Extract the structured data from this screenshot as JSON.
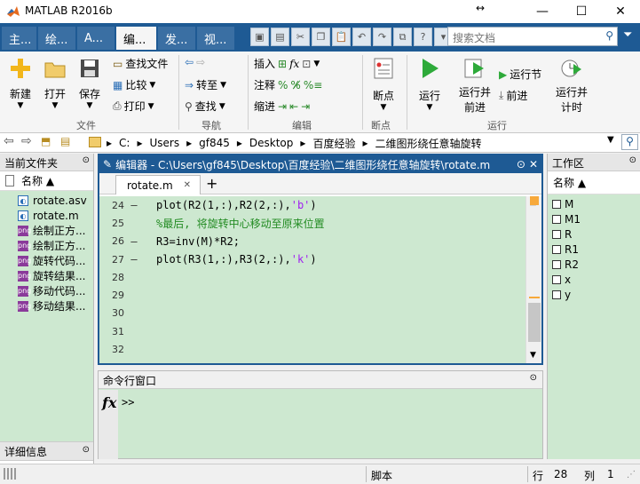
{
  "window": {
    "title": "MATLAB R2016b",
    "minimize": "—",
    "maximize": "☐",
    "close": "✕"
  },
  "tabs": [
    "主...",
    "绘...",
    "A...",
    "编...",
    "发...",
    "视..."
  ],
  "search": {
    "placeholder": "搜索文档"
  },
  "ribbon": {
    "new": "新建",
    "open": "打开",
    "save": "保存",
    "find_files": "查找文件",
    "compare": "比较",
    "print": "打印",
    "goto": "转至",
    "find": "查找",
    "insert": "插入",
    "comment": "注释",
    "indent": "缩进",
    "breakpoints": "断点",
    "run": "运行",
    "run_advance": [
      "运行并",
      "前进"
    ],
    "run_section": "运行节",
    "advance": "前进",
    "run_time": [
      "运行并",
      "计时"
    ],
    "groups": {
      "file": "文件",
      "navigate": "导航",
      "edit": "编辑",
      "breakpoints": "断点",
      "run": "运行"
    }
  },
  "path": [
    "C:",
    "Users",
    "gf845",
    "Desktop",
    "百度经验",
    "二维图形绕任意轴旋转"
  ],
  "current_folder": {
    "title": "当前文件夹",
    "column": "名称 ▲",
    "files": [
      "rotate.asv",
      "rotate.m",
      "绘制正方...",
      "绘制正方...",
      "旋转代码...",
      "旋转结果...",
      "移动代码...",
      "移动结果..."
    ],
    "details": "详细信息"
  },
  "editor": {
    "title": "编辑器 - C:\\Users\\gf845\\Desktop\\百度经验\\二维图形绕任意轴旋转\\rotate.m",
    "tab": "rotate.m",
    "lines": [
      {
        "num": "24",
        "dash": "—",
        "code": "plot(R2(1,:),R2(2,:),'b')"
      },
      {
        "num": "25",
        "dash": "",
        "code": "%最后, 将旋转中心移动至原来位置"
      },
      {
        "num": "26",
        "dash": "—",
        "code": "R3=inv(M)*R2;"
      },
      {
        "num": "27",
        "dash": "—",
        "code": "plot(R3(1,:),R3(2,:),'k')"
      },
      {
        "num": "28",
        "dash": "",
        "code": ""
      },
      {
        "num": "29",
        "dash": "",
        "code": ""
      },
      {
        "num": "30",
        "dash": "",
        "code": ""
      },
      {
        "num": "31",
        "dash": "",
        "code": ""
      },
      {
        "num": "32",
        "dash": "",
        "code": ""
      }
    ]
  },
  "command_window": {
    "title": "命令行窗口",
    "fx": "fx",
    "prompt": ">>"
  },
  "workspace": {
    "title": "工作区",
    "column": "名称 ▲",
    "vars": [
      "M",
      "M1",
      "R",
      "R1",
      "R2",
      "x",
      "y"
    ]
  },
  "status": {
    "mode": "脚本",
    "row_label": "行",
    "row": "28",
    "col_label": "列",
    "col": "1"
  },
  "colors": {
    "accent": "#1e5a94",
    "editor_bg": "#cde8d0",
    "comment": "#228b22",
    "string": "#a020f0"
  }
}
